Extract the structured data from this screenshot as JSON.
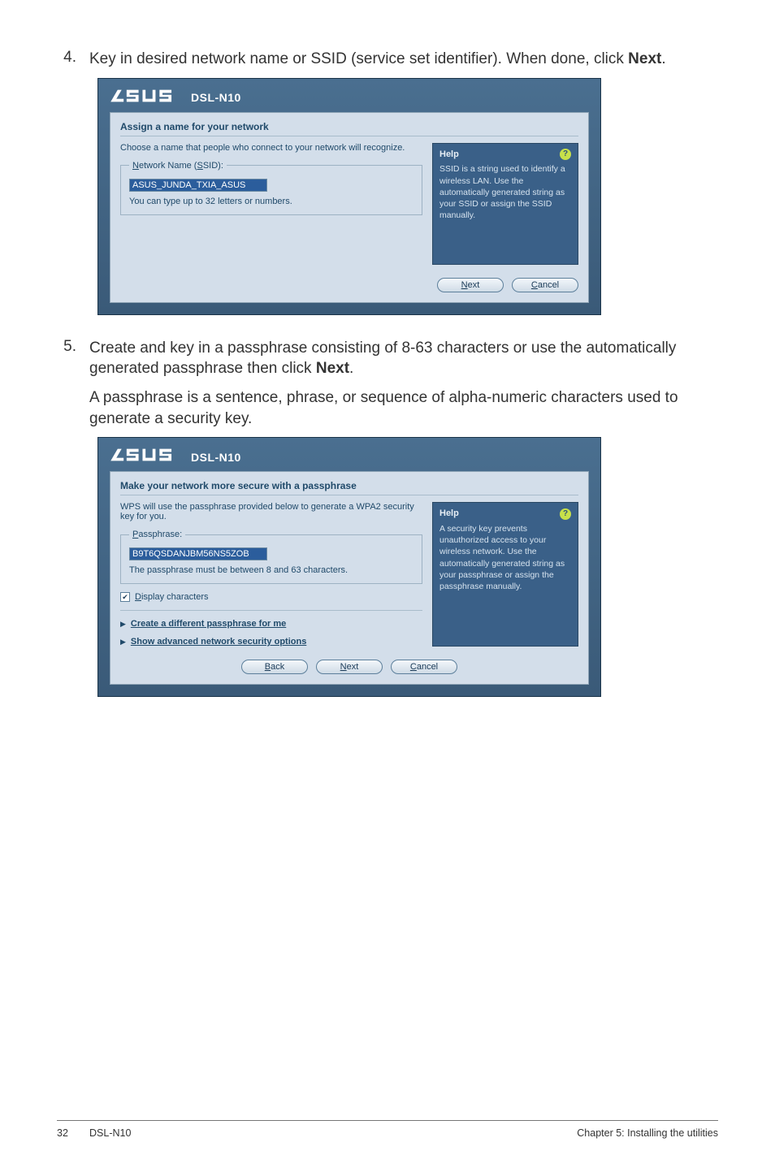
{
  "step4": {
    "num": "4.",
    "text_a": "Key in desired network name or SSID (service set identifier). When done, click ",
    "bold": "Next",
    "text_b": "."
  },
  "dialog1": {
    "model": "DSL-N10",
    "title": "Assign a name for your network",
    "intro": "Choose a name that people who connect to your network will recognize.",
    "fieldset_legend": "Network Name (SSID):",
    "input_value": "ASUS_JUNDA_TXIA_ASUS",
    "hint": "You can type up to 32 letters or numbers.",
    "help_title": "Help",
    "help_body": "SSID is a string used to identify a wireless LAN. Use the automatically generated string as your SSID or assign the SSID manually.",
    "btn_next": "Next",
    "btn_next_u": "N",
    "btn_cancel": "Cancel",
    "btn_cancel_u": "C"
  },
  "step5": {
    "num": "5.",
    "text_a": "Create and key in a passphrase consisting of 8-63 characters or use the automatically generated passphrase then click ",
    "bold": "Next",
    "text_b": ".",
    "para2": "A passphrase is a sentence, phrase, or sequence of alpha-numeric characters used to generate a security key."
  },
  "dialog2": {
    "model": "DSL-N10",
    "title": "Make your network more secure with a passphrase",
    "intro": "WPS will use the passphrase provided below to generate a WPA2 security key for you.",
    "fieldset_legend": "Passphrase:",
    "input_value": "B9T6QSDANJBM56NS5ZOB",
    "hint": "The passphrase must be between 8 and 63 characters.",
    "checkbox_label": "Display characters",
    "checkbox_u": "D",
    "link1": "Create a different passphrase for me",
    "link1_u": "C",
    "link2": "Show advanced network security options",
    "link2_u": "S",
    "help_title": "Help",
    "help_body": "A security key prevents unauthorized access to your wireless network. Use the automatically generated string as your passphrase or assign the passphrase manually.",
    "btn_back": "Back",
    "btn_back_u": "B",
    "btn_next": "Next",
    "btn_next_u": "N",
    "btn_cancel": "Cancel",
    "btn_cancel_u": "C"
  },
  "footer": {
    "page": "32",
    "model": "DSL-N10",
    "chapter": "Chapter 5: Installing the utilities"
  }
}
